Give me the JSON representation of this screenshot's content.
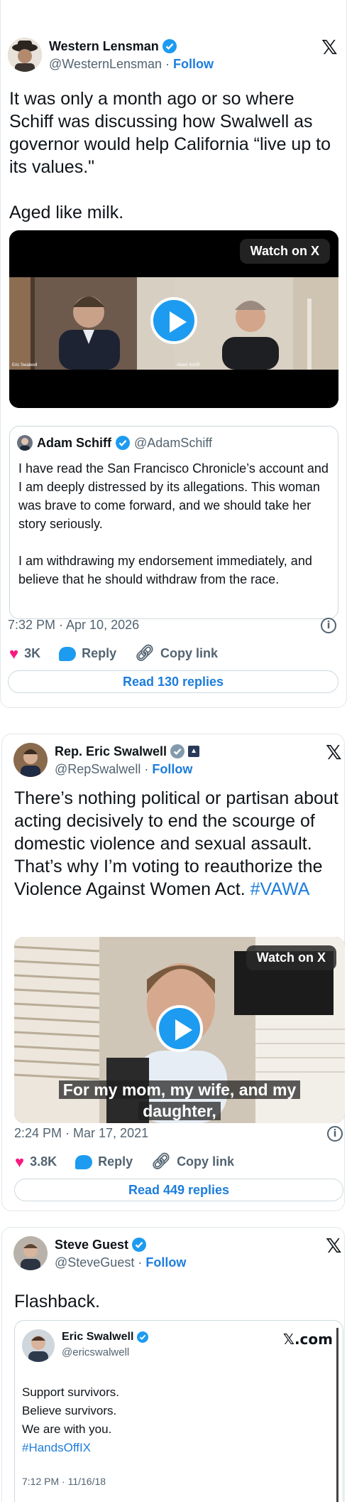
{
  "tweets": [
    {
      "author": {
        "name": "Western Lensman",
        "handle": "@WesternLensman",
        "follow": "Follow",
        "separator": "·"
      },
      "text": "It was only a month ago or so where Schiff was discussing how Swalwell as governor would help California “live up to its values.\"\n\nAged like milk.",
      "video": {
        "watch_label": "Watch on X",
        "name_left": "Eric Swalwell",
        "name_right": "Adam Schiff"
      },
      "quote": {
        "name": "Adam Schiff",
        "handle": "@AdamSchiff",
        "text": "I have read the San Francisco Chronicle’s account and I am deeply distressed by its allegations. This woman was brave to come forward, and we should take her story seriously.\n\nI am withdrawing my endorsement immediately, and believe that he should withdraw from the race."
      },
      "timestamp": "7:32 PM · Apr 10, 2026",
      "likes": "3K",
      "reply_label": "Reply",
      "copy_label": "Copy link",
      "read_replies": "Read 130 replies"
    },
    {
      "author": {
        "name": "Rep. Eric Swalwell",
        "handle": "@RepSwalwell",
        "follow": "Follow",
        "separator": "·"
      },
      "text": "There’s nothing political or partisan about acting decisively to end the scourge of domestic violence and sexual assault. That’s why I’m voting to reauthorize the Violence Against Women Act. ",
      "hashtag": "#VAWA",
      "video": {
        "watch_label": "Watch on X",
        "caption": "For my mom, my wife, and my daughter,"
      },
      "timestamp": "2:24 PM · Mar 17, 2021",
      "likes": "3.8K",
      "reply_label": "Reply",
      "copy_label": "Copy link",
      "read_replies": "Read 449 replies"
    },
    {
      "author": {
        "name": "Steve Guest",
        "handle": "@SteveGuest",
        "follow": "Follow",
        "separator": "·"
      },
      "text": "Flashback.",
      "embedded": {
        "name": "Eric Swalwell",
        "handle": "@ericswalwell",
        "site": "𝕏.com",
        "lines": [
          "Support survivors.",
          "Believe survivors.",
          "We are with you."
        ],
        "hashtag": "#HandsOffIX",
        "timestamp": "7:12 PM · 11/16/18"
      }
    }
  ],
  "colors": {
    "accent": "#1d9bf0",
    "link": "#1d7ddc",
    "like": "#f91880",
    "muted": "#536471"
  },
  "icons": {
    "close": "x-logo-icon",
    "play": "play-icon",
    "info": "info-icon",
    "like": "heart-icon",
    "reply": "reply-icon",
    "copy": "link-icon"
  }
}
